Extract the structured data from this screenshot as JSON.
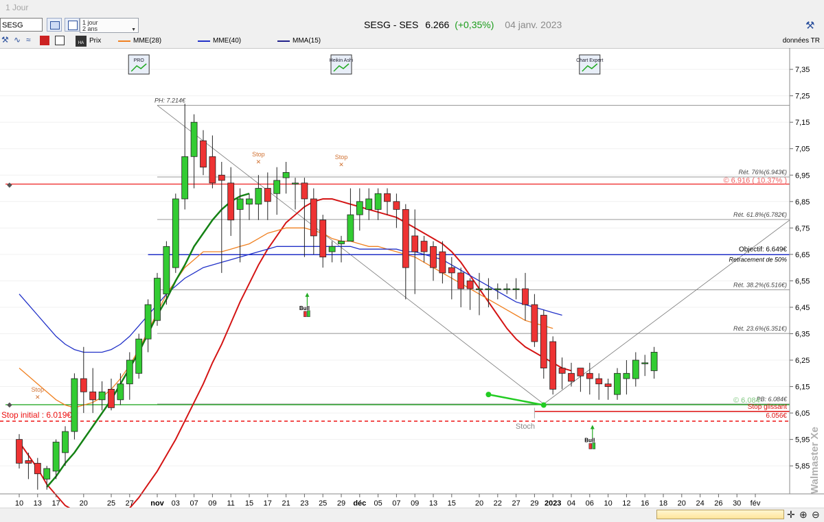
{
  "window": {
    "title": "1 Jour"
  },
  "toolbar": {
    "ticker": "SESG",
    "period_main": "1 jour",
    "period_sub": "2 ans",
    "quote": {
      "name": "SESG - SES",
      "price": "6.266",
      "change": "(+0,35%)",
      "date": "04 janv. 2023"
    },
    "data_source": "données TR"
  },
  "legend": [
    {
      "label": "Prix",
      "color": "#000000"
    },
    {
      "label": "MME(28)",
      "color": "#f08020"
    },
    {
      "label": "MME(40)",
      "color": "#2030c8"
    },
    {
      "label": "MMA(15)",
      "color": "#20208a"
    }
  ],
  "colors": {
    "bull": "#33cc33",
    "bear": "#ee3333",
    "mma15": "#d41414",
    "mme28": "#f08020",
    "mme40": "#2030c8",
    "ema_green": "#148214",
    "objective": "#2030c8",
    "resistance": "#ee2222",
    "support": "#10a010"
  },
  "chart_data": {
    "type": "candlestick",
    "y_ticks": [
      "7,35",
      "7,25",
      "7,15",
      "7,05",
      "6,95",
      "6,85",
      "6,75",
      "6,65",
      "6,55",
      "6,45",
      "6,35",
      "6,25",
      "6,15",
      "6,05",
      "5,95",
      "5,85"
    ],
    "ylim": [
      5.77,
      7.41
    ],
    "x_ticks": [
      {
        "i": 0,
        "label": "10"
      },
      {
        "i": 2,
        "label": "13"
      },
      {
        "i": 4,
        "label": "17"
      },
      {
        "i": 7,
        "label": "20"
      },
      {
        "i": 10,
        "label": "25"
      },
      {
        "i": 12,
        "label": "27"
      },
      {
        "i": 15,
        "label": "nov"
      },
      {
        "i": 17,
        "label": "03"
      },
      {
        "i": 19,
        "label": "07"
      },
      {
        "i": 21,
        "label": "09"
      },
      {
        "i": 23,
        "label": "11"
      },
      {
        "i": 25,
        "label": "15"
      },
      {
        "i": 27,
        "label": "17"
      },
      {
        "i": 29,
        "label": "21"
      },
      {
        "i": 31,
        "label": "23"
      },
      {
        "i": 33,
        "label": "25"
      },
      {
        "i": 35,
        "label": "29"
      },
      {
        "i": 37,
        "label": "déc"
      },
      {
        "i": 39,
        "label": "05"
      },
      {
        "i": 41,
        "label": "07"
      },
      {
        "i": 43,
        "label": "09"
      },
      {
        "i": 45,
        "label": "13"
      },
      {
        "i": 47,
        "label": "15"
      },
      {
        "i": 50,
        "label": "20"
      },
      {
        "i": 52,
        "label": "22"
      },
      {
        "i": 54,
        "label": "27"
      },
      {
        "i": 56,
        "label": "29"
      },
      {
        "i": 58,
        "label": "2023"
      },
      {
        "i": 60,
        "label": "04"
      },
      {
        "i": 62,
        "label": "06"
      },
      {
        "i": 64,
        "label": "10"
      },
      {
        "i": 66,
        "label": "12"
      },
      {
        "i": 68,
        "label": "16"
      },
      {
        "i": 70,
        "label": "18"
      },
      {
        "i": 72,
        "label": "20"
      },
      {
        "i": 74,
        "label": "24"
      },
      {
        "i": 76,
        "label": "26"
      },
      {
        "i": 78,
        "label": "30"
      },
      {
        "i": 80,
        "label": "fév"
      }
    ],
    "candles": [
      [
        5.95,
        5.97,
        5.84,
        5.86
      ],
      [
        5.87,
        5.9,
        5.8,
        5.86
      ],
      [
        5.86,
        5.88,
        5.76,
        5.82
      ],
      [
        5.8,
        5.85,
        5.76,
        5.84
      ],
      [
        5.83,
        5.95,
        5.8,
        5.94
      ],
      [
        5.9,
        6.0,
        5.85,
        5.98
      ],
      [
        5.98,
        6.2,
        5.95,
        6.18
      ],
      [
        6.18,
        6.3,
        6.05,
        6.13
      ],
      [
        6.13,
        6.22,
        6.05,
        6.1
      ],
      [
        6.1,
        6.17,
        6.06,
        6.13
      ],
      [
        6.14,
        6.18,
        6.06,
        6.07
      ],
      [
        6.1,
        6.2,
        6.08,
        6.16
      ],
      [
        6.16,
        6.28,
        6.1,
        6.25
      ],
      [
        6.2,
        6.35,
        6.18,
        6.33
      ],
      [
        6.33,
        6.48,
        6.28,
        6.46
      ],
      [
        6.4,
        6.58,
        6.38,
        6.56
      ],
      [
        6.5,
        6.7,
        6.46,
        6.68
      ],
      [
        6.6,
        6.88,
        6.58,
        6.86
      ],
      [
        6.86,
        7.22,
        6.82,
        7.02
      ],
      [
        7.02,
        7.18,
        6.9,
        7.15
      ],
      [
        7.08,
        7.12,
        6.95,
        6.98
      ],
      [
        7.02,
        7.1,
        6.9,
        6.92
      ],
      [
        6.95,
        7.0,
        6.58,
        6.93
      ],
      [
        6.92,
        6.98,
        6.72,
        6.78
      ],
      [
        6.82,
        6.9,
        6.62,
        6.86
      ],
      [
        6.84,
        6.88,
        6.78,
        6.86
      ],
      [
        6.84,
        6.95,
        6.78,
        6.9
      ],
      [
        6.9,
        6.96,
        6.78,
        6.85
      ],
      [
        6.88,
        6.98,
        6.8,
        6.93
      ],
      [
        6.94,
        7.0,
        6.88,
        6.96
      ],
      [
        6.92,
        6.94,
        6.82,
        6.92
      ],
      [
        6.92,
        6.94,
        6.64,
        6.86
      ],
      [
        6.86,
        6.9,
        6.65,
        6.72
      ],
      [
        6.78,
        6.8,
        6.6,
        6.64
      ],
      [
        6.66,
        6.7,
        6.62,
        6.68
      ],
      [
        6.69,
        6.72,
        6.62,
        6.7
      ],
      [
        6.7,
        6.9,
        6.7,
        6.8
      ],
      [
        6.8,
        6.9,
        6.74,
        6.85
      ],
      [
        6.82,
        6.9,
        6.78,
        6.86
      ],
      [
        6.82,
        6.9,
        6.78,
        6.88
      ],
      [
        6.88,
        6.9,
        6.8,
        6.85
      ],
      [
        6.85,
        6.88,
        6.75,
        6.82
      ],
      [
        6.82,
        6.84,
        6.48,
        6.6
      ],
      [
        6.72,
        6.82,
        6.5,
        6.66
      ],
      [
        6.7,
        6.72,
        6.62,
        6.66
      ],
      [
        6.68,
        6.7,
        6.55,
        6.6
      ],
      [
        6.66,
        6.7,
        6.54,
        6.58
      ],
      [
        6.6,
        6.64,
        6.48,
        6.58
      ],
      [
        6.58,
        6.6,
        6.45,
        6.52
      ],
      [
        6.55,
        6.56,
        6.44,
        6.52
      ],
      [
        6.52,
        6.58,
        6.42,
        6.52
      ],
      [
        6.52,
        6.56,
        6.45,
        6.52
      ],
      [
        6.52,
        6.54,
        6.48,
        6.52
      ],
      [
        6.52,
        6.54,
        6.5,
        6.52
      ],
      [
        6.52,
        6.56,
        6.48,
        6.52
      ],
      [
        6.52,
        6.58,
        6.4,
        6.46
      ],
      [
        6.46,
        6.5,
        6.3,
        6.32
      ],
      [
        6.42,
        6.44,
        6.18,
        6.22
      ],
      [
        6.32,
        6.34,
        6.12,
        6.14
      ],
      [
        6.22,
        6.26,
        6.14,
        6.2
      ],
      [
        6.2,
        6.24,
        6.15,
        6.17
      ],
      [
        6.22,
        6.22,
        6.13,
        6.19
      ],
      [
        6.2,
        6.24,
        6.12,
        6.18
      ],
      [
        6.18,
        6.2,
        6.1,
        6.16
      ],
      [
        6.16,
        6.18,
        6.1,
        6.15
      ],
      [
        6.12,
        6.22,
        6.1,
        6.2
      ],
      [
        6.18,
        6.25,
        6.12,
        6.2
      ],
      [
        6.18,
        6.28,
        6.15,
        6.25
      ],
      [
        6.24,
        6.27,
        6.19,
        6.24
      ],
      [
        6.21,
        6.3,
        6.18,
        6.28
      ]
    ],
    "series": [
      {
        "name": "MMA(15)",
        "color": "#d41414",
        "start": 0,
        "values": [
          5.94,
          5.89,
          5.84,
          5.78,
          5.74,
          5.7,
          5.68,
          5.66,
          5.64,
          5.63,
          5.64,
          5.66,
          5.69,
          5.73,
          5.78,
          5.83,
          5.89,
          5.95,
          6.02,
          6.09,
          6.16,
          6.24,
          6.31,
          6.39,
          6.47,
          6.54,
          6.61,
          6.67,
          6.72,
          6.77,
          6.8,
          6.83,
          6.85,
          6.86,
          6.86,
          6.85,
          6.84,
          6.83,
          6.82,
          6.81,
          6.8,
          6.79,
          6.77,
          6.75,
          6.73,
          6.71,
          6.69,
          6.66,
          6.62,
          6.57,
          6.52,
          6.47,
          6.42,
          6.37,
          6.33,
          6.3,
          6.28,
          6.26,
          6.24,
          6.22,
          6.21
        ]
      },
      {
        "name": "MME(28)",
        "color": "#f08020",
        "start": 0,
        "values": [
          6.22,
          6.19,
          6.16,
          6.13,
          6.1,
          6.08,
          6.07,
          6.08,
          6.09,
          6.11,
          6.14,
          6.18,
          6.23,
          6.29,
          6.36,
          6.43,
          6.5,
          6.55,
          6.6,
          6.63,
          6.66,
          6.66,
          6.66,
          6.67,
          6.68,
          6.69,
          6.71,
          6.73,
          6.74,
          6.75,
          6.75,
          6.75,
          6.74,
          6.73,
          6.71,
          6.7,
          6.7,
          6.69,
          6.68,
          6.68,
          6.67,
          6.66,
          6.65,
          6.64,
          6.62,
          6.6,
          6.58,
          6.56,
          6.54,
          6.52,
          6.5,
          6.48,
          6.46,
          6.44,
          6.42,
          6.4,
          6.39,
          6.38,
          6.37
        ]
      },
      {
        "name": "MME(40)",
        "color": "#2030c8",
        "start": 0,
        "values": [
          6.5,
          6.46,
          6.42,
          6.38,
          6.34,
          6.31,
          6.29,
          6.28,
          6.28,
          6.28,
          6.29,
          6.31,
          6.34,
          6.38,
          6.42,
          6.46,
          6.5,
          6.53,
          6.56,
          6.58,
          6.6,
          6.61,
          6.62,
          6.63,
          6.64,
          6.65,
          6.66,
          6.67,
          6.68,
          6.68,
          6.68,
          6.68,
          6.68,
          6.68,
          6.68,
          6.68,
          6.68,
          6.67,
          6.67,
          6.67,
          6.67,
          6.67,
          6.66,
          6.66,
          6.65,
          6.64,
          6.63,
          6.61,
          6.59,
          6.57,
          6.55,
          6.53,
          6.51,
          6.49,
          6.47,
          6.46,
          6.45,
          6.44,
          6.43,
          6.42
        ]
      },
      {
        "name": "",
        "color": "#148214",
        "start": 3,
        "values": [
          5.77,
          5.81,
          5.86,
          5.9,
          5.95,
          6.0,
          6.05,
          6.1,
          6.16,
          6.22,
          6.28,
          6.35,
          6.42,
          6.48,
          6.55,
          6.61,
          6.68,
          6.73,
          6.78,
          6.82,
          6.85,
          6.87,
          6.88
        ]
      }
    ],
    "hlines": [
      {
        "label": "PH: 7.214€",
        "value": 7.214
      },
      {
        "label": "Rét. 76%(6.943€)",
        "value": 6.943
      },
      {
        "label": "Rét. 61.8%(6.782€)",
        "value": 6.782
      },
      {
        "label": "Rét. 38.2%(6.516€)",
        "value": 6.516
      },
      {
        "label": "Rét. 23.6%(6.351€)",
        "value": 6.351
      },
      {
        "label": "PB: 6.084€",
        "value": 6.084
      }
    ],
    "resistance": {
      "label": "© 6.916 ( 10.37% )",
      "value": 6.916
    },
    "objective": {
      "label": "Objectif: 6.649€",
      "sublabel": "Retracement de 50%",
      "value": 6.649
    },
    "support": {
      "label": "© 6.084",
      "value": 6.084
    },
    "stop_glissant": {
      "label": "Stop glissant",
      "value_label": "6.056€",
      "value": 6.056
    },
    "stop_initial": {
      "label": "Stop initial : 6.019€",
      "value": 6.019
    },
    "markers": [
      {
        "type": "stop",
        "label": "Stop",
        "i": 2,
        "value": 6.12
      },
      {
        "type": "stop",
        "label": "Stop",
        "i": 26,
        "value": 7.01
      },
      {
        "type": "stop",
        "label": "Stop",
        "i": 35,
        "value": 7.0
      },
      {
        "type": "bull",
        "label": "Bull",
        "i": 31,
        "value": 6.44
      },
      {
        "type": "bull",
        "label": "Bull",
        "i": 62,
        "value": 5.94
      }
    ],
    "annotations": {
      "stoch": "Stoch"
    },
    "badges": [
      {
        "label": "PRO",
        "i": 13
      },
      {
        "label": "Heikin Ashi",
        "i": 35
      },
      {
        "label": "Chart Expert",
        "i": 62
      }
    ]
  },
  "watermark": "Walmaster Xe"
}
